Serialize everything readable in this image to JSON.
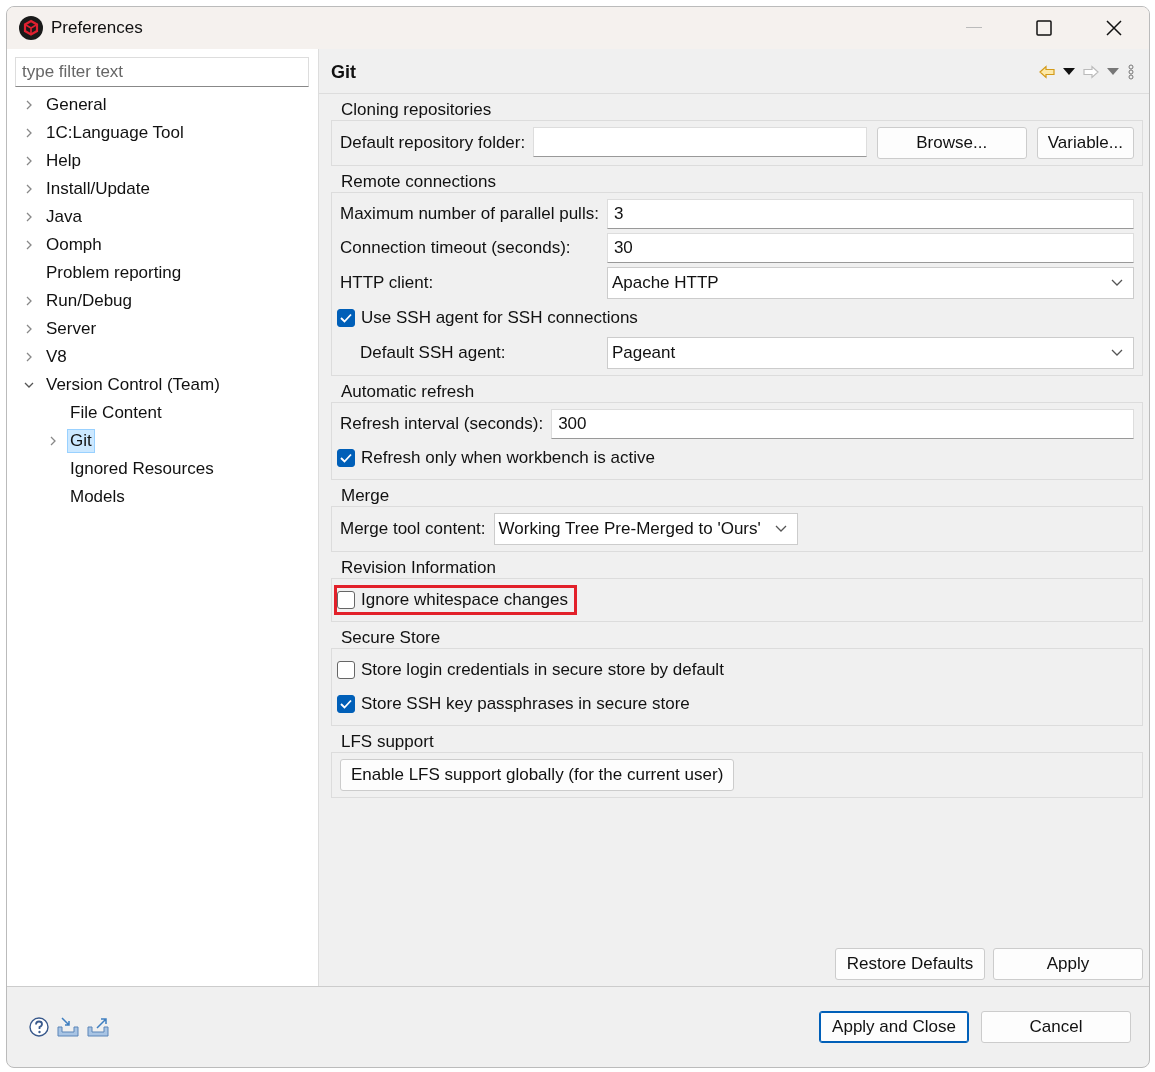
{
  "window": {
    "title": "Preferences"
  },
  "filter": {
    "placeholder": "type filter text"
  },
  "tree": [
    {
      "label": "General",
      "expandable": true,
      "expanded": false,
      "selected": false
    },
    {
      "label": "1C:Language Tool",
      "expandable": true,
      "expanded": false,
      "selected": false
    },
    {
      "label": "Help",
      "expandable": true,
      "expanded": false,
      "selected": false
    },
    {
      "label": "Install/Update",
      "expandable": true,
      "expanded": false,
      "selected": false
    },
    {
      "label": "Java",
      "expandable": true,
      "expanded": false,
      "selected": false
    },
    {
      "label": "Oomph",
      "expandable": true,
      "expanded": false,
      "selected": false
    },
    {
      "label": "Problem reporting",
      "expandable": false,
      "expanded": false,
      "selected": false
    },
    {
      "label": "Run/Debug",
      "expandable": true,
      "expanded": false,
      "selected": false
    },
    {
      "label": "Server",
      "expandable": true,
      "expanded": false,
      "selected": false
    },
    {
      "label": "V8",
      "expandable": true,
      "expanded": false,
      "selected": false
    },
    {
      "label": "Version Control (Team)",
      "expandable": true,
      "expanded": true,
      "selected": false,
      "children": [
        {
          "label": "File Content",
          "expandable": false,
          "expanded": false,
          "selected": false
        },
        {
          "label": "Git",
          "expandable": true,
          "expanded": false,
          "selected": true
        },
        {
          "label": "Ignored Resources",
          "expandable": false,
          "expanded": false,
          "selected": false
        },
        {
          "label": "Models",
          "expandable": false,
          "expanded": false,
          "selected": false
        }
      ]
    }
  ],
  "page": {
    "title": "Git"
  },
  "sections": [
    {
      "title": "Cloning repositories",
      "rows": [
        {
          "kind": "field",
          "label": "Default repository folder:",
          "value": "",
          "buttons": [
            "Browse...",
            "Variable..."
          ]
        }
      ]
    },
    {
      "title": "Remote connections",
      "rows": [
        {
          "kind": "field",
          "label": "Maximum number of parallel pulls:",
          "value": "3"
        },
        {
          "kind": "field",
          "label": "Connection timeout (seconds):",
          "value": "30"
        },
        {
          "kind": "dropdown",
          "label": "HTTP client:",
          "value": "Apache HTTP"
        },
        {
          "kind": "checkbox",
          "label": "Use SSH agent for SSH connections",
          "checked": true,
          "highlighted": false
        },
        {
          "kind": "dropdown",
          "label": "Default SSH agent:",
          "value": "Pageant",
          "indented": true
        }
      ]
    },
    {
      "title": "Automatic refresh",
      "rows": [
        {
          "kind": "field",
          "label": "Refresh interval (seconds):",
          "value": "300"
        },
        {
          "kind": "checkbox",
          "label": "Refresh only when workbench is active",
          "checked": true,
          "highlighted": false
        }
      ]
    },
    {
      "title": "Merge",
      "rows": [
        {
          "kind": "combo",
          "label": "Merge tool content:",
          "value": "Working Tree Pre-Merged to 'Ours'"
        }
      ]
    },
    {
      "title": "Revision Information",
      "rows": [
        {
          "kind": "checkbox",
          "label": "Ignore whitespace changes",
          "checked": false,
          "highlighted": true
        }
      ]
    },
    {
      "title": "Secure Store",
      "rows": [
        {
          "kind": "checkbox",
          "label": "Store login credentials in secure store by default",
          "checked": false,
          "highlighted": false
        },
        {
          "kind": "checkbox",
          "label": "Store SSH key passphrases in secure store",
          "checked": true,
          "highlighted": false
        }
      ]
    },
    {
      "title": "LFS support",
      "rows": [
        {
          "kind": "button",
          "label": "Enable LFS support globally (for the current user)"
        }
      ]
    }
  ],
  "page_buttons": [
    "Restore Defaults",
    "Apply"
  ],
  "dialog_buttons": [
    {
      "label": "Apply and Close",
      "default": true
    },
    {
      "label": "Cancel",
      "default": false
    }
  ]
}
